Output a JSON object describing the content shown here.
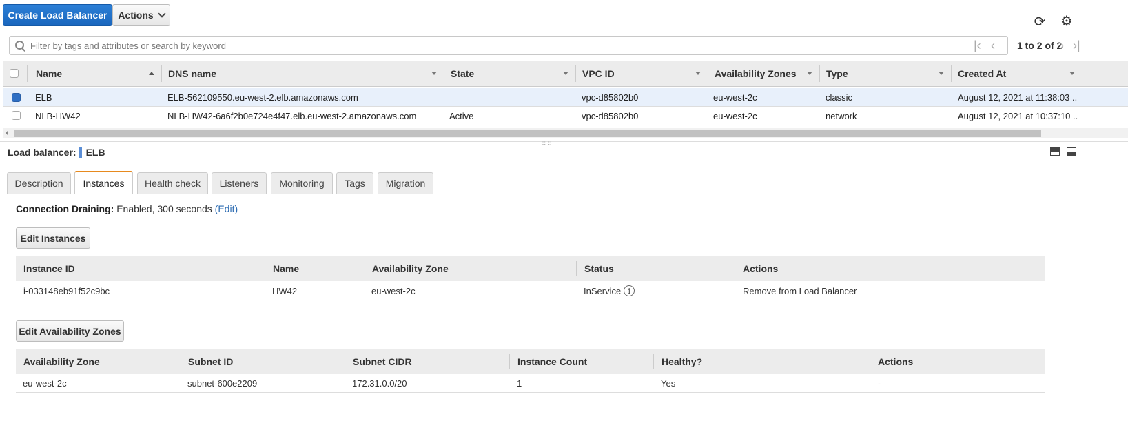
{
  "toolbar": {
    "create_label": "Create Load Balancer",
    "actions_label": "Actions",
    "refresh_icon": "refresh-icon",
    "settings_icon": "gear-icon"
  },
  "filter": {
    "placeholder": "Filter by tags and attributes or search by keyword",
    "value": ""
  },
  "pagination": {
    "text": "1 to 2 of 2"
  },
  "grid": {
    "columns": [
      "Name",
      "DNS name",
      "State",
      "VPC ID",
      "Availability Zones",
      "Type",
      "Created At"
    ],
    "rows": [
      {
        "selected": true,
        "name": "ELB",
        "dns": "ELB-562109550.eu-west-2.elb.amazonaws.com",
        "state": "",
        "vpc": "vpc-d85802b0",
        "az": "eu-west-2c",
        "type": "classic",
        "created": "August 12, 2021 at 11:38:03 ..."
      },
      {
        "selected": false,
        "name": "NLB-HW42",
        "dns": "NLB-HW42-6a6f2b0e724e4f47.elb.eu-west-2.amazonaws.com",
        "state": "Active",
        "vpc": "vpc-d85802b0",
        "az": "eu-west-2c",
        "type": "network",
        "created": "August 12, 2021 at 10:37:10 ..."
      }
    ]
  },
  "detail": {
    "label": "Load balancer:",
    "name": "ELB",
    "tabs": [
      "Description",
      "Instances",
      "Health check",
      "Listeners",
      "Monitoring",
      "Tags",
      "Migration"
    ],
    "active_tab": "Instances",
    "connection_draining_label": "Connection Draining:",
    "connection_draining_value": "Enabled, 300 seconds",
    "edit_link": "(Edit)",
    "edit_instances_label": "Edit Instances",
    "instances": {
      "columns": [
        "Instance ID",
        "Name",
        "Availability Zone",
        "Status",
        "Actions"
      ],
      "rows": [
        {
          "id": "i-033148eb91f52c9bc",
          "name": "HW42",
          "az": "eu-west-2c",
          "status": "InService",
          "action": "Remove from Load Balancer"
        }
      ]
    },
    "edit_az_label": "Edit Availability Zones",
    "zones": {
      "columns": [
        "Availability Zone",
        "Subnet ID",
        "Subnet CIDR",
        "Instance Count",
        "Healthy?",
        "Actions"
      ],
      "rows": [
        {
          "az": "eu-west-2c",
          "subnet": "subnet-600e2209",
          "cidr": "172.31.0.0/20",
          "count": "1",
          "healthy": "Yes",
          "action": "-"
        }
      ]
    }
  }
}
